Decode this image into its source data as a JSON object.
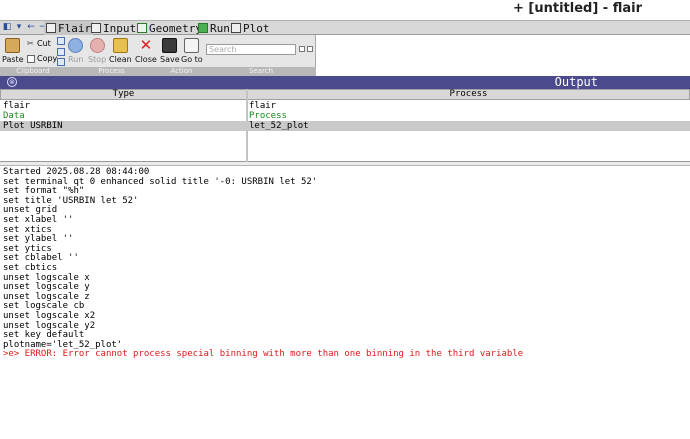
{
  "window": {
    "title": "+ [untitled] - flair"
  },
  "nav": [
    "◧",
    "▾",
    "←",
    "→"
  ],
  "tabs": [
    {
      "label": "Flair",
      "icon": "flair-icon"
    },
    {
      "label": "Input",
      "icon": "input-icon"
    },
    {
      "label": "Geometry",
      "icon": "geometry-icon"
    },
    {
      "label": "Run",
      "icon": "run-icon"
    },
    {
      "label": "Plot",
      "icon": "plot-icon"
    }
  ],
  "ribbon": {
    "clipboard": {
      "label": "Clipboard",
      "paste": "Paste",
      "cut": "Cut",
      "copy": "Copy"
    },
    "process": {
      "label": "Process",
      "run": "Run",
      "stop": "Stop",
      "clean": "Clean",
      "close": "Close"
    },
    "action": {
      "label": "Action",
      "save": "Save",
      "goto": "Go to"
    },
    "search": {
      "label": "Search",
      "placeholder": "Search"
    }
  },
  "output": {
    "title": "Output"
  },
  "table": {
    "columns": [
      "Type",
      "Process"
    ],
    "rows": [
      {
        "type": "flair",
        "process": "flair"
      },
      {
        "type": "Data",
        "process": "Process"
      },
      {
        "type": "Plot USRBIN",
        "process": "let_52_plot"
      }
    ]
  },
  "log": [
    "Started 2025.08.28 08:44:00",
    "set terminal qt 0 enhanced solid title '-0: USRBIN let 52'",
    "set format \"%h\"",
    "set title 'USRBIN let 52'",
    "unset grid",
    "set xlabel ''",
    "set xtics",
    "set ylabel ''",
    "set ytics",
    "set cblabel ''",
    "set cbtics",
    "unset logscale x",
    "unset logscale y",
    "unset logscale z",
    "set logscale cb",
    "unset logscale x2",
    "unset logscale y2",
    "set key default",
    "plotname='let_52_plot'"
  ],
  "error": ">e> ERROR: Error cannot process special binning with more than one binning in the third variable",
  "colors": {
    "output_header": "#4b4a8c",
    "error": "#e01818",
    "data_green": "#1a8a1a"
  }
}
